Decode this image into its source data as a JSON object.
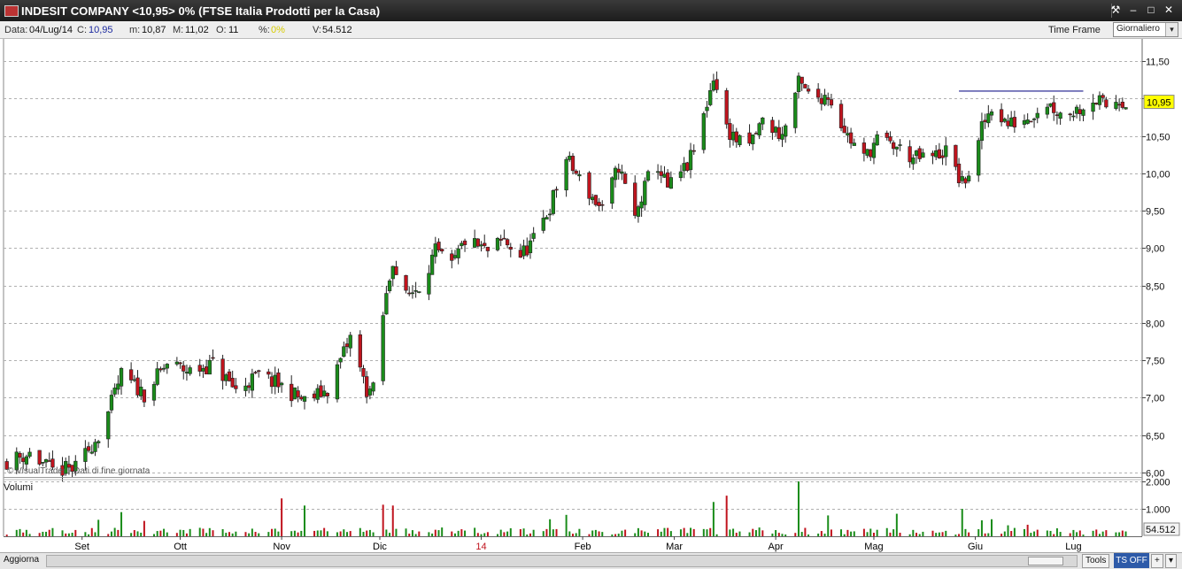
{
  "window": {
    "title": "INDESIT COMPANY <10,95> 0%  (FTSE Italia Prodotti per la Casa)",
    "buttons": {
      "tool": "⚒",
      "minimize": "–",
      "maximize": "□",
      "close": "✕"
    }
  },
  "info": {
    "date_label": "Data:",
    "date": "04/Lug/14",
    "close_label": "C:",
    "close": "10,95",
    "min_label": "m:",
    "min": "10,87",
    "max_label": "M:",
    "max": "11,02",
    "open_label": "O:",
    "open": "11",
    "pct_label": "%:",
    "pct": "0%",
    "vol_label": "V:",
    "vol": "54.512",
    "timeframe_label": "Time Frame",
    "timeframe_value": "Giornaliero"
  },
  "footer": {
    "refresh": "Aggiorna",
    "tools": "Tools",
    "tsoff": "TS OFF",
    "plus": "+",
    "arrow": "▾"
  },
  "colors": {
    "up": "#1a8c1a",
    "down": "#c0141e",
    "grid": "#b0b0b0",
    "price_tag": "#ffff00",
    "resistance": "#1a1a8c"
  },
  "chart_data": {
    "type": "candlestick",
    "watermark": "© VisualTrader - Dati di fine giornata",
    "y_ticks": [
      "6,00",
      "6,50",
      "7,00",
      "7,50",
      "8,00",
      "8,50",
      "9,00",
      "9,50",
      "10,00",
      "10,50",
      "11,00",
      "11,50"
    ],
    "ylim": [
      5.95,
      11.75
    ],
    "last_price": "10,95",
    "resistance_line": {
      "from": "2014-05-27",
      "to": "2014-07-04",
      "value": 11.1
    },
    "x_labels": [
      {
        "label": "Set",
        "date": "2013-09-01",
        "color": "#000000"
      },
      {
        "label": "Ott",
        "date": "2013-10-01",
        "color": "#000000"
      },
      {
        "label": "Nov",
        "date": "2013-11-01",
        "color": "#000000"
      },
      {
        "label": "Dic",
        "date": "2013-12-01",
        "color": "#000000"
      },
      {
        "label": "14",
        "date": "2014-01-01",
        "color": "#c0141e"
      },
      {
        "label": "Feb",
        "date": "2014-02-01",
        "color": "#000000"
      },
      {
        "label": "Mar",
        "date": "2014-03-01",
        "color": "#000000"
      },
      {
        "label": "Apr",
        "date": "2014-04-01",
        "color": "#000000"
      },
      {
        "label": "Mag",
        "date": "2014-05-01",
        "color": "#000000"
      },
      {
        "label": "Giu",
        "date": "2014-06-01",
        "color": "#000000"
      },
      {
        "label": "Lug",
        "date": "2014-07-01",
        "color": "#000000"
      }
    ],
    "close_path": [
      [
        "2013-08-09",
        6.15
      ],
      [
        "2013-08-16",
        6.25
      ],
      [
        "2013-08-23",
        6.02
      ],
      [
        "2013-08-30",
        6.05
      ],
      [
        "2013-09-06",
        6.5
      ],
      [
        "2013-09-09",
        6.8
      ],
      [
        "2013-09-13",
        7.3
      ],
      [
        "2013-09-20",
        7.05
      ],
      [
        "2013-09-27",
        7.45
      ],
      [
        "2013-10-04",
        7.35
      ],
      [
        "2013-10-11",
        7.45
      ],
      [
        "2013-10-18",
        7.1
      ],
      [
        "2013-10-25",
        7.3
      ],
      [
        "2013-11-01",
        7.15
      ],
      [
        "2013-11-08",
        6.95
      ],
      [
        "2013-11-15",
        7.1
      ],
      [
        "2013-11-22",
        7.8
      ],
      [
        "2013-11-27",
        7.1
      ],
      [
        "2013-11-29",
        7.1
      ],
      [
        "2013-11-30",
        7.55
      ],
      [
        "2013-12-02",
        8.1
      ],
      [
        "2013-12-05",
        8.85
      ],
      [
        "2013-12-08",
        8.3
      ],
      [
        "2013-12-13",
        8.5
      ],
      [
        "2013-12-18",
        8.95
      ],
      [
        "2013-12-23",
        8.75
      ],
      [
        "2013-12-27",
        9.1
      ],
      [
        "2014-01-03",
        8.95
      ],
      [
        "2014-01-08",
        9.1
      ],
      [
        "2014-01-13",
        8.9
      ],
      [
        "2014-01-17",
        9.1
      ],
      [
        "2014-01-22",
        9.55
      ],
      [
        "2014-01-27",
        10.2
      ],
      [
        "2014-02-01",
        9.85
      ],
      [
        "2014-02-07",
        9.5
      ],
      [
        "2014-02-12",
        10.1
      ],
      [
        "2014-02-17",
        9.4
      ],
      [
        "2014-02-23",
        10.2
      ],
      [
        "2014-02-27",
        9.8
      ],
      [
        "2014-03-05",
        10.1
      ],
      [
        "2014-03-08",
        10.4
      ],
      [
        "2014-03-13",
        11.3
      ],
      [
        "2014-03-17",
        10.6
      ],
      [
        "2014-03-23",
        10.3
      ],
      [
        "2014-03-28",
        10.7
      ],
      [
        "2014-04-03",
        10.5
      ],
      [
        "2014-04-08",
        11.2
      ],
      [
        "2014-04-12",
        11.0
      ],
      [
        "2014-04-17",
        11.05
      ],
      [
        "2014-04-23",
        10.5
      ],
      [
        "2014-04-28",
        10.2
      ],
      [
        "2014-05-02",
        10.45
      ],
      [
        "2014-05-08",
        10.35
      ],
      [
        "2014-05-13",
        10.2
      ],
      [
        "2014-05-18",
        10.2
      ],
      [
        "2014-05-23",
        10.3
      ],
      [
        "2014-05-28",
        9.85
      ],
      [
        "2014-06-01",
        10.15
      ],
      [
        "2014-06-03",
        10.6
      ],
      [
        "2014-06-06",
        10.9
      ],
      [
        "2014-06-11",
        10.65
      ],
      [
        "2014-06-17",
        10.75
      ],
      [
        "2014-06-23",
        10.95
      ],
      [
        "2014-06-27",
        10.8
      ],
      [
        "2014-07-02",
        10.85
      ],
      [
        "2014-07-07",
        11.0
      ],
      [
        "2014-07-11",
        10.9
      ],
      [
        "2014-07-15",
        11.0
      ],
      [
        "2014-07-17",
        10.95
      ]
    ],
    "volume_label": "Volumi",
    "volume_ticks": [
      "1.000",
      "2.000"
    ],
    "volume_ylim": [
      0,
      2000
    ],
    "last_volume": "54.512",
    "volume_spikes": [
      [
        "2013-09-06",
        600
      ],
      [
        "2013-09-13",
        880
      ],
      [
        "2013-09-20",
        560
      ],
      [
        "2013-11-01",
        1380
      ],
      [
        "2013-11-08",
        1120
      ],
      [
        "2013-12-02",
        1150
      ],
      [
        "2013-12-05",
        1120
      ],
      [
        "2013-12-08",
        480
      ],
      [
        "2014-01-22",
        620
      ],
      [
        "2014-01-27",
        780
      ],
      [
        "2014-03-08",
        1350
      ],
      [
        "2014-03-13",
        1250
      ],
      [
        "2014-03-17",
        1480
      ],
      [
        "2014-03-23",
        820
      ],
      [
        "2014-04-08",
        2000
      ],
      [
        "2014-04-12",
        900
      ],
      [
        "2014-04-17",
        760
      ],
      [
        "2014-05-08",
        820
      ],
      [
        "2014-05-28",
        1000
      ],
      [
        "2014-06-03",
        580
      ],
      [
        "2014-06-06",
        620
      ],
      [
        "2014-06-11",
        400
      ],
      [
        "2014-06-17",
        420
      ]
    ]
  }
}
